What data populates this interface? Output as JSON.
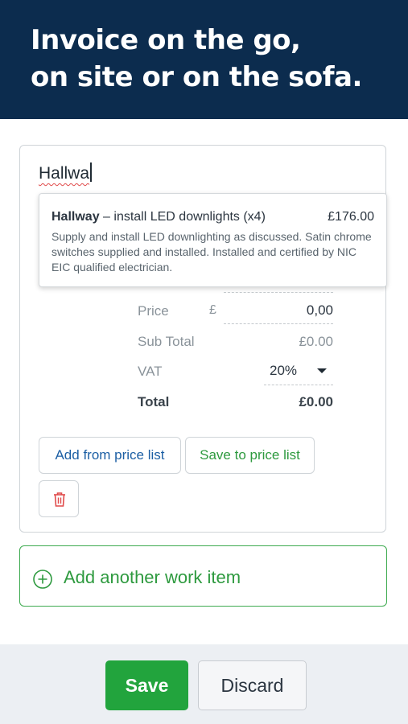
{
  "hero": {
    "line1": "Invoice on the go,",
    "line2": "on site or on the sofa."
  },
  "item_form": {
    "name_input": {
      "value": "Hallwa"
    },
    "suggestion": {
      "title_match": "Hallway",
      "title_rest": " – install LED downlights (x4)",
      "price": "£176.00",
      "description": "Supply and install LED downlighting as discussed. Satin chrome switches supplied and installed. Installed and certified by NIC EIC qualified electrician."
    },
    "price_row": {
      "label": "Price",
      "currency": "£",
      "value": "0,00"
    },
    "subtotal_row": {
      "label": "Sub Total",
      "value": "£0.00"
    },
    "vat_row": {
      "label": "VAT",
      "selected": "20%"
    },
    "total_row": {
      "label": "Total",
      "value": "£0.00"
    },
    "buttons": {
      "add_from_price_list": "Add from price list",
      "save_to_price_list": "Save to price list"
    }
  },
  "add_work_item": {
    "label": "Add another work item"
  },
  "footer": {
    "save": "Save",
    "discard": "Discard"
  },
  "colors": {
    "hero_bg": "#0c2c4e",
    "accent_green": "#22a43d",
    "link_blue": "#1c5fa4",
    "danger_red": "#e04a4a"
  }
}
